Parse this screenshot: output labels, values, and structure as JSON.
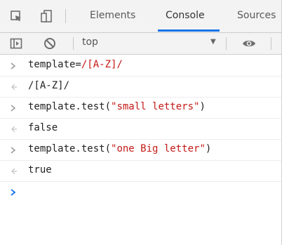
{
  "tabs": [
    {
      "label": "Elements"
    },
    {
      "label": "Console"
    },
    {
      "label": "Sources"
    }
  ],
  "toolbar": {
    "context_value": "top"
  },
  "console_lines": [
    {
      "kind": "input",
      "text_a": "template=",
      "text_b": "/[A-Z]/"
    },
    {
      "kind": "output",
      "text": "/[A-Z]/"
    },
    {
      "kind": "input",
      "text_a": "template.test(",
      "text_b": "\"small letters\"",
      "text_c": ")"
    },
    {
      "kind": "output",
      "text": "false"
    },
    {
      "kind": "input",
      "text_a": "template.test(",
      "text_b": "\"one Big letter\"",
      "text_c": ")"
    },
    {
      "kind": "output",
      "text": "true"
    }
  ],
  "colors": {
    "string": "#c41a16",
    "keyword": "#1a1aa6",
    "accent": "#1a73e8"
  }
}
